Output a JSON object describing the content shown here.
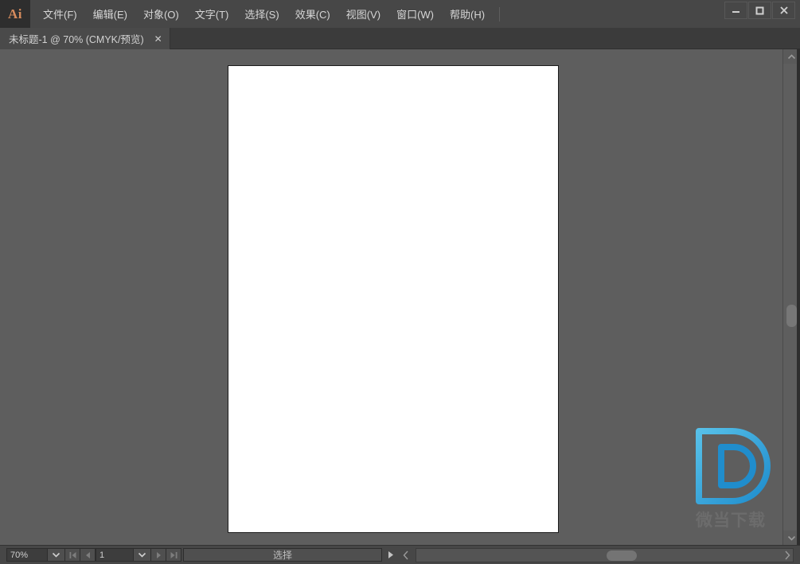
{
  "app": {
    "logo_text": "Ai",
    "accent_color": "#d58b5d",
    "canvas_bg": "#5e5e5e",
    "chrome_bg": "#474747"
  },
  "menu": {
    "items": [
      {
        "label": "文件(F)",
        "name": "menu-file"
      },
      {
        "label": "编辑(E)",
        "name": "menu-edit"
      },
      {
        "label": "对象(O)",
        "name": "menu-object"
      },
      {
        "label": "文字(T)",
        "name": "menu-type"
      },
      {
        "label": "选择(S)",
        "name": "menu-select"
      },
      {
        "label": "效果(C)",
        "name": "menu-effect"
      },
      {
        "label": "视图(V)",
        "name": "menu-view"
      },
      {
        "label": "窗口(W)",
        "name": "menu-window"
      },
      {
        "label": "帮助(H)",
        "name": "menu-help"
      }
    ]
  },
  "window_controls": {
    "minimize": "minimize-icon",
    "maximize": "maximize-icon",
    "close": "close-icon"
  },
  "tabs": [
    {
      "label": "未标题-1 @ 70% (CMYK/预览)",
      "close_label": "✕",
      "active": true
    }
  ],
  "document": {
    "artboard_color": "#ffffff",
    "zoom_percent": "70%"
  },
  "watermark": {
    "logo_alt": "D",
    "text": "微当下载",
    "logo_color_outer": "#4db8e8",
    "logo_color_inner": "#1f8fd0",
    "text_color": "#6d6d6d"
  },
  "statusbar": {
    "zoom_value": "70%",
    "zoom_dropdown_icon": "chevron-down-icon",
    "nav_first_icon": "first-page-icon",
    "nav_prev_icon": "previous-page-icon",
    "page_value": "1",
    "page_dropdown_icon": "chevron-down-icon",
    "nav_next_icon": "next-page-icon",
    "nav_last_icon": "last-page-icon",
    "tool_status": "选择",
    "play_icon": "play-icon",
    "collapse_icon": "chevron-left-icon",
    "hscroll_right_icon": "chevron-right-icon"
  },
  "scrollbars": {
    "vertical_up_icon": "chevron-up-icon",
    "vertical_down_icon": "chevron-down-icon"
  }
}
